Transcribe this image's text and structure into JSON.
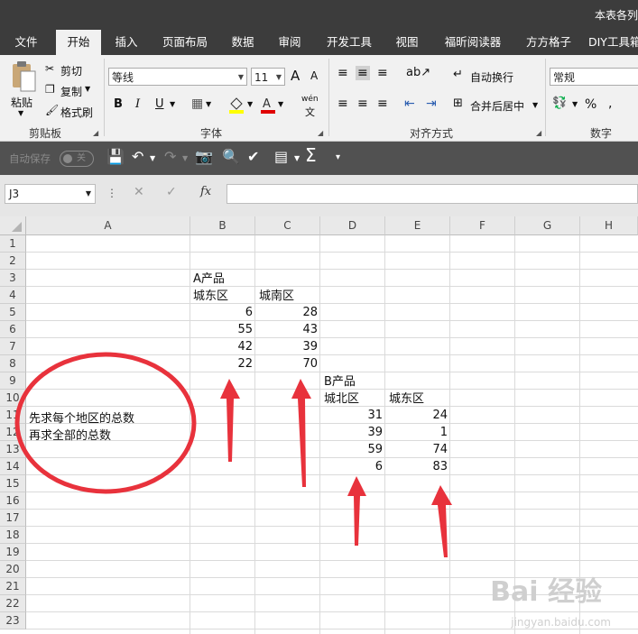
{
  "window": {
    "title": "本表各列"
  },
  "tabs": [
    "文件",
    "开始",
    "插入",
    "页面布局",
    "数据",
    "审阅",
    "开发工具",
    "视图",
    "福昕阅读器",
    "方方格子",
    "DIY工具箱"
  ],
  "ribbon": {
    "clipboard": {
      "paste": "粘贴",
      "cut": "剪切",
      "copy": "复制",
      "format_painter": "格式刷",
      "label": "剪贴板"
    },
    "font": {
      "name": "等线",
      "size": "11",
      "label": "字体",
      "bold": "B",
      "italic": "I",
      "underline": "U",
      "grow": "A",
      "shrink": "A",
      "phonetic": "wén"
    },
    "alignment": {
      "wrap": "自动换行",
      "merge": "合并后居中",
      "label": "对齐方式"
    },
    "number": {
      "format": "常规",
      "label": "数字",
      "percent": "%"
    }
  },
  "qat": {
    "autosave": "自动保存",
    "autosave_state": "关"
  },
  "formula_bar": {
    "name_box": "J3",
    "fx": "fx",
    "cancel": "✕",
    "enter": "✓"
  },
  "sheet": {
    "columns": [
      "A",
      "B",
      "C",
      "D",
      "E",
      "F",
      "G",
      "H"
    ],
    "rows": [
      "1",
      "2",
      "3",
      "4",
      "5",
      "6",
      "7",
      "8",
      "9",
      "10",
      "11",
      "12",
      "13",
      "14",
      "15",
      "16",
      "17",
      "18",
      "19",
      "20",
      "21",
      "22",
      "23"
    ],
    "product_a": {
      "title": "A产品",
      "h1": "城东区",
      "h2": "城南区",
      "col1": [
        6,
        55,
        42,
        22
      ],
      "col2": [
        28,
        43,
        39,
        70
      ]
    },
    "product_b": {
      "title": "B产品",
      "h1": "城北区",
      "h2": "城东区",
      "col1": [
        31,
        39,
        59,
        6
      ],
      "col2": [
        24,
        1,
        74,
        83
      ]
    },
    "note": {
      "line1": "先求每个地区的总数",
      "line2": "再求全部的总数"
    }
  },
  "annotation_color": "#e8323c",
  "watermark": {
    "text": "Bai 经验",
    "url": "jingyan.baidu.com"
  }
}
